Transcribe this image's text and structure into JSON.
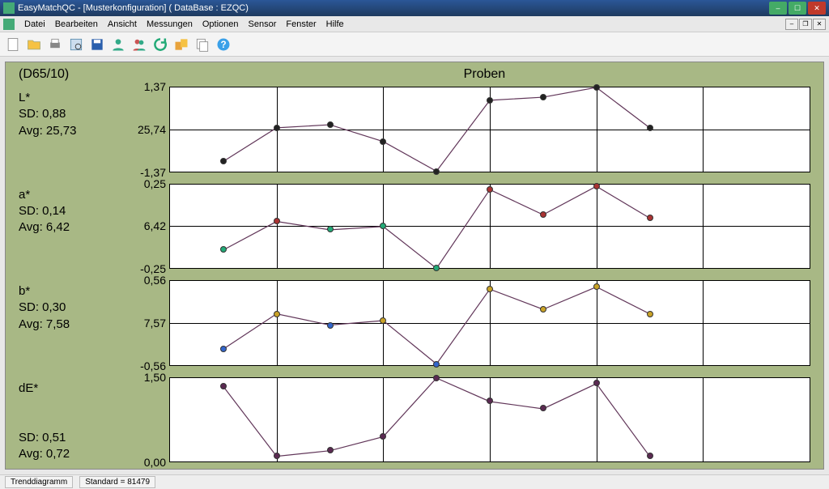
{
  "window": {
    "title": "EasyMatchQC - [Musterkonfiguration]   ( DataBase : EZQC)"
  },
  "menu": {
    "items": [
      "Datei",
      "Bearbeiten",
      "Ansicht",
      "Messungen",
      "Optionen",
      "Sensor",
      "Fenster",
      "Hilfe"
    ]
  },
  "toolbar_icons": [
    "new",
    "open",
    "print",
    "print-preview",
    "save",
    "user1",
    "user2",
    "refresh",
    "move",
    "copy",
    "help"
  ],
  "panel": {
    "heading": "(D65/10)",
    "chart_title": "Proben"
  },
  "statusbar": {
    "tab": "Trenddiagramm",
    "standard": "Standard = 81479"
  },
  "chart_meta": [
    {
      "name": "L*",
      "sd": "SD: 0,88",
      "avg": "Avg: 25,73",
      "ticks": [
        "1,37",
        "25,74",
        "-1,37"
      ],
      "color": "#222"
    },
    {
      "name": "a*",
      "sd": "SD: 0,14",
      "avg": "Avg: 6,42",
      "ticks": [
        "0,25",
        "6,42",
        "-0,25"
      ],
      "color_map": [
        "#2a7",
        "#a33",
        "#2a7",
        "#2a7",
        "#2a7",
        "#a33",
        "#a33",
        "#a33",
        "#a33"
      ],
      "color": "#2a7"
    },
    {
      "name": "b*",
      "sd": "SD: 0,30",
      "avg": "Avg: 7,58",
      "ticks": [
        "0,56",
        "7,57",
        "-0,56"
      ],
      "color_map": [
        "#36c",
        "#c9a227",
        "#36c",
        "#c9a227",
        "#36c",
        "#c9a227",
        "#c9a227",
        "#c9a227",
        "#c9a227"
      ],
      "color": "#c9a227"
    },
    {
      "name": "dE*",
      "sd": "SD: 0,51",
      "avg": "Avg: 0,72",
      "ticks": [
        "1,50",
        "",
        "0,00"
      ],
      "color": "#5b2a52",
      "de": true
    }
  ],
  "chart_data": [
    {
      "type": "line",
      "title": "L* trend",
      "ylabel": "L*",
      "ylim": [
        -1.37,
        1.37
      ],
      "center": 25.74,
      "x": [
        1,
        2,
        3,
        4,
        5,
        6,
        7,
        8,
        9
      ],
      "values": [
        -1.05,
        0.05,
        0.15,
        -0.4,
        -1.37,
        0.95,
        1.05,
        1.37,
        0.05
      ]
    },
    {
      "type": "line",
      "title": "a* trend",
      "ylabel": "a*",
      "ylim": [
        -0.25,
        0.25
      ],
      "center": 6.42,
      "x": [
        1,
        2,
        3,
        4,
        5,
        6,
        7,
        8,
        9
      ],
      "values": [
        -0.14,
        0.03,
        -0.02,
        0.0,
        -0.25,
        0.22,
        0.07,
        0.24,
        0.05
      ]
    },
    {
      "type": "line",
      "title": "b* trend",
      "ylabel": "b*",
      "ylim": [
        -0.56,
        0.56
      ],
      "center": 7.57,
      "x": [
        1,
        2,
        3,
        4,
        5,
        6,
        7,
        8,
        9
      ],
      "values": [
        -0.35,
        0.12,
        -0.03,
        0.03,
        -0.55,
        0.45,
        0.18,
        0.48,
        0.12
      ]
    },
    {
      "type": "line",
      "title": "dE* trend",
      "ylabel": "dE*",
      "ylim": [
        0.0,
        1.5
      ],
      "x": [
        1,
        2,
        3,
        4,
        5,
        6,
        7,
        8,
        9
      ],
      "values": [
        1.35,
        0.1,
        0.2,
        0.45,
        1.5,
        1.08,
        0.95,
        1.4,
        0.1
      ]
    }
  ]
}
